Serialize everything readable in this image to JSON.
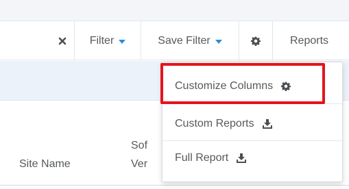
{
  "toolbar": {
    "clear_icon": "close-icon",
    "filter_label": "Filter",
    "save_filter_label": "Save Filter",
    "settings_icon": "gear-icon",
    "reports_label": "Reports"
  },
  "table": {
    "columns": [
      "Site Name",
      "Sof",
      "Ver"
    ]
  },
  "reports_menu": {
    "items": [
      {
        "label": "Customize Columns",
        "icon": "gear-icon"
      },
      {
        "label": "Custom Reports",
        "icon": "download-icon"
      },
      {
        "label": "Full Report",
        "icon": "download-icon"
      }
    ],
    "highlighted_item": "Customize Columns"
  },
  "colors": {
    "accent": "#2a8fd8",
    "highlight": "#e5141b",
    "text": "#55595c",
    "band": "#ecf2f9"
  }
}
